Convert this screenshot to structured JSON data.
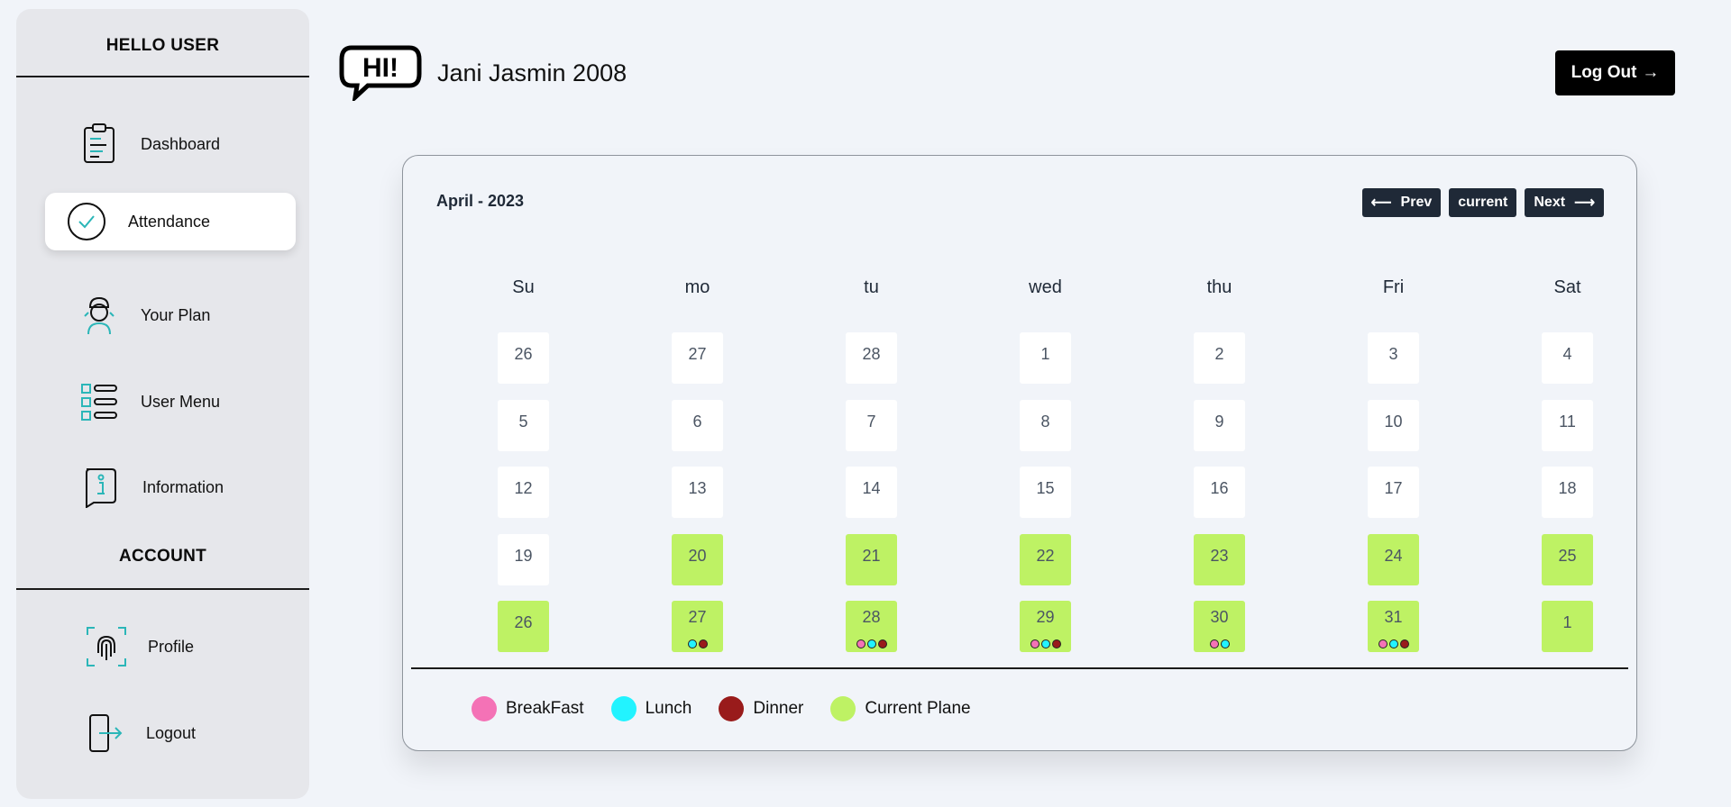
{
  "sidebar": {
    "greeting": "HELLO USER",
    "account_heading": "ACCOUNT",
    "items": [
      {
        "label": "Dashboard",
        "icon": "clipboard-icon"
      },
      {
        "label": "Attendance",
        "icon": "check-circle-icon"
      },
      {
        "label": "Your Plan",
        "icon": "chef-icon"
      },
      {
        "label": "User Menu",
        "icon": "list-icon"
      },
      {
        "label": "Information",
        "icon": "info-bubble-icon"
      }
    ],
    "account_items": [
      {
        "label": "Profile",
        "icon": "fingerprint-icon"
      },
      {
        "label": "Logout",
        "icon": "logout-icon"
      }
    ]
  },
  "header": {
    "logo_text": "HI!",
    "user_name": "Jani Jasmin 2008",
    "logout_label": "Log Out"
  },
  "calendar": {
    "month_title": "April - 2023",
    "prev_label": "Prev",
    "current_label": "current",
    "next_label": "Next",
    "weekdays": [
      "Su",
      "mo",
      "tu",
      "wed",
      "thu",
      "Fri",
      "Sat"
    ],
    "weeks": [
      [
        {
          "d": "26"
        },
        {
          "d": "27"
        },
        {
          "d": "28"
        },
        {
          "d": "1"
        },
        {
          "d": "2"
        },
        {
          "d": "3"
        },
        {
          "d": "4"
        }
      ],
      [
        {
          "d": "5"
        },
        {
          "d": "6"
        },
        {
          "d": "7"
        },
        {
          "d": "8"
        },
        {
          "d": "9"
        },
        {
          "d": "10"
        },
        {
          "d": "11"
        }
      ],
      [
        {
          "d": "12"
        },
        {
          "d": "13"
        },
        {
          "d": "14"
        },
        {
          "d": "15"
        },
        {
          "d": "16"
        },
        {
          "d": "17"
        },
        {
          "d": "18"
        }
      ],
      [
        {
          "d": "19"
        },
        {
          "d": "20",
          "plan": true
        },
        {
          "d": "21",
          "plan": true
        },
        {
          "d": "22",
          "plan": true
        },
        {
          "d": "23",
          "plan": true
        },
        {
          "d": "24",
          "plan": true
        },
        {
          "d": "25",
          "plan": true
        }
      ],
      [
        {
          "d": "26",
          "plan": true
        },
        {
          "d": "27",
          "plan": true,
          "meals": [
            "l",
            "d"
          ]
        },
        {
          "d": "28",
          "plan": true,
          "meals": [
            "b",
            "l",
            "d"
          ]
        },
        {
          "d": "29",
          "plan": true,
          "meals": [
            "b",
            "l",
            "d"
          ]
        },
        {
          "d": "30",
          "plan": true,
          "meals": [
            "b",
            "l"
          ]
        },
        {
          "d": "31",
          "plan": true,
          "meals": [
            "b",
            "l",
            "d"
          ]
        },
        {
          "d": "1",
          "plan": true
        }
      ]
    ],
    "legend": [
      {
        "label": "BreakFast",
        "color": "#f472b6"
      },
      {
        "label": "Lunch",
        "color": "#22f3ff"
      },
      {
        "label": "Dinner",
        "color": "#991b1b"
      },
      {
        "label": "Current Plane",
        "color": "#bef264"
      }
    ]
  }
}
